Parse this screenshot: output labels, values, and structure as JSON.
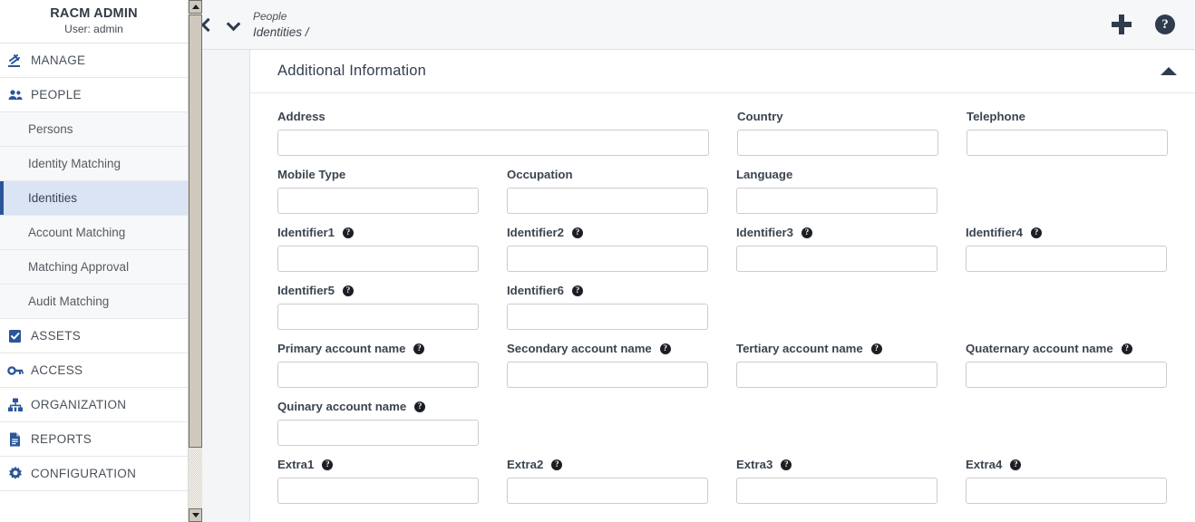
{
  "sidebar": {
    "brand_title": "RACM ADMIN",
    "brand_user": "User: admin",
    "groups": [
      {
        "label": "MANAGE",
        "icon": "gavel-icon"
      },
      {
        "label": "PEOPLE",
        "icon": "people-icon"
      }
    ],
    "people_items": [
      {
        "label": "Persons",
        "active": false
      },
      {
        "label": "Identity Matching",
        "active": false
      },
      {
        "label": "Identities",
        "active": true
      },
      {
        "label": "Account Matching",
        "active": false
      },
      {
        "label": "Matching Approval",
        "active": false
      },
      {
        "label": "Audit Matching",
        "active": false
      }
    ],
    "lower_groups": [
      {
        "label": "ASSETS",
        "icon": "clipboard-check-icon"
      },
      {
        "label": "ACCESS",
        "icon": "key-icon"
      },
      {
        "label": "ORGANIZATION",
        "icon": "org-chart-icon"
      },
      {
        "label": "REPORTS",
        "icon": "document-icon"
      },
      {
        "label": "CONFIGURATION",
        "icon": "gear-icon"
      }
    ],
    "active_bar_color": "#2a5699",
    "active_bg_color": "#dbe4f4"
  },
  "topbar": {
    "back_icon": "chevron-left-icon",
    "dropdown_icon": "chevron-down-icon",
    "breadcrumb_parent": "People",
    "breadcrumb_current": "Identities /",
    "add_icon": "plus-icon",
    "help_icon": "help-circle-icon",
    "help_glyph": "?"
  },
  "card": {
    "title": "Additional Information",
    "collapse_icon": "caret-up-icon",
    "help_glyph": "?"
  },
  "form": {
    "rows": [
      {
        "fields": [
          {
            "label": "Address",
            "width": "w2",
            "value": "",
            "help": false
          },
          {
            "label": "Country",
            "width": "w1",
            "value": "",
            "help": false
          },
          {
            "label": "Telephone",
            "width": "w1",
            "value": "",
            "help": false
          }
        ]
      },
      {
        "fields": [
          {
            "label": "Mobile Type",
            "width": "w1",
            "value": "",
            "help": false
          },
          {
            "label": "Occupation",
            "width": "w1",
            "value": "",
            "help": false
          },
          {
            "label": "Language",
            "width": "w1",
            "value": "",
            "help": false
          }
        ]
      },
      {
        "fields": [
          {
            "label": "Identifier1",
            "width": "w1",
            "value": "",
            "help": true
          },
          {
            "label": "Identifier2",
            "width": "w1",
            "value": "",
            "help": true
          },
          {
            "label": "Identifier3",
            "width": "w1",
            "value": "",
            "help": true
          },
          {
            "label": "Identifier4",
            "width": "w1",
            "value": "",
            "help": true
          }
        ]
      },
      {
        "fields": [
          {
            "label": "Identifier5",
            "width": "w1",
            "value": "",
            "help": true
          },
          {
            "label": "Identifier6",
            "width": "w1",
            "value": "",
            "help": true
          }
        ]
      },
      {
        "fields": [
          {
            "label": "Primary account name",
            "width": "w1",
            "value": "",
            "help": true
          },
          {
            "label": "Secondary account name",
            "width": "w1",
            "value": "",
            "help": true
          },
          {
            "label": "Tertiary account name",
            "width": "w1",
            "value": "",
            "help": true
          },
          {
            "label": "Quaternary account name",
            "width": "w1",
            "value": "",
            "help": true
          }
        ]
      },
      {
        "fields": [
          {
            "label": "Quinary account name",
            "width": "w1",
            "value": "",
            "help": true
          }
        ]
      },
      {
        "fields": [
          {
            "label": "Extra1",
            "width": "w1",
            "value": "",
            "help": true
          },
          {
            "label": "Extra2",
            "width": "w1",
            "value": "",
            "help": true
          },
          {
            "label": "Extra3",
            "width": "w1",
            "value": "",
            "help": true
          },
          {
            "label": "Extra4",
            "width": "w1",
            "value": "",
            "help": true
          }
        ]
      }
    ]
  }
}
